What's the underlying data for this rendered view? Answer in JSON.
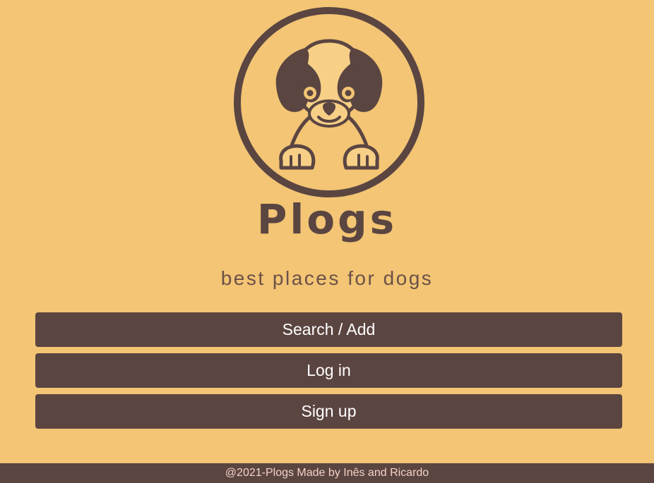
{
  "brand": {
    "name": "Plogs",
    "tagline": "best places for dogs"
  },
  "actions": {
    "search_add_label": "Search / Add",
    "login_label": "Log in",
    "signup_label": "Sign up"
  },
  "footer": {
    "text": "@2021-Plogs  Made by  Inês and  Ricardo"
  },
  "colors": {
    "background": "#f3c574",
    "accent": "#5b4541",
    "button_text": "#ffffff",
    "footer_text": "#f2d2c7"
  },
  "icons": {
    "logo": "dog-logo-icon"
  }
}
